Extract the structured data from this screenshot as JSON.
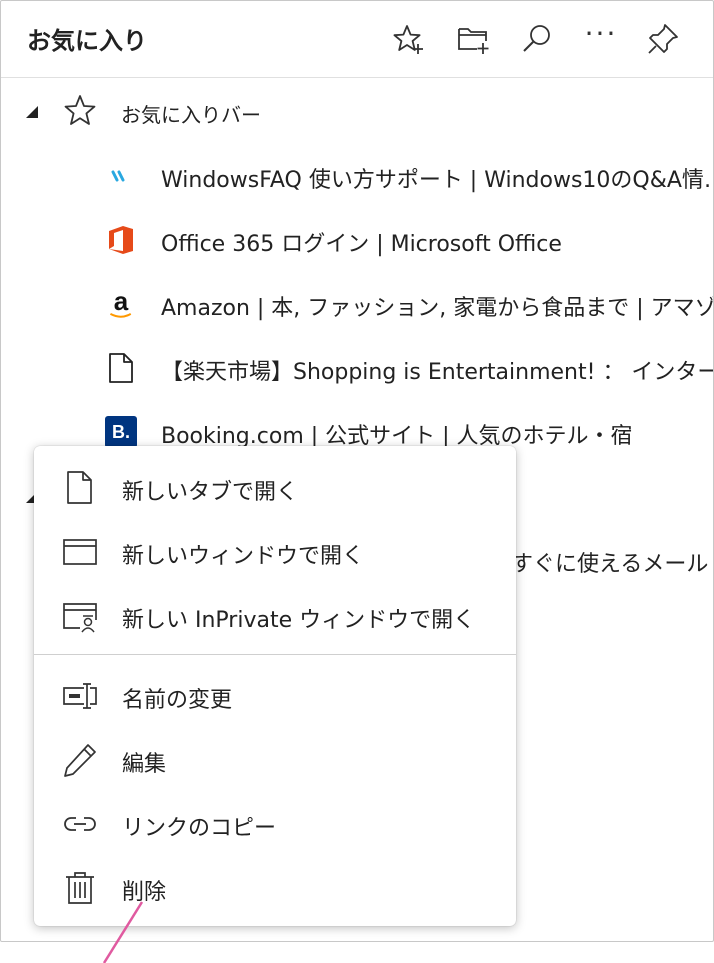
{
  "header": {
    "title": "お気に入り",
    "actions": [
      {
        "name": "add-favorite",
        "icon": "star-plus-icon"
      },
      {
        "name": "add-folder",
        "icon": "folder-plus-icon"
      },
      {
        "name": "search",
        "icon": "search-icon"
      },
      {
        "name": "more",
        "icon": "more-icon",
        "label": "···"
      },
      {
        "name": "pin",
        "icon": "pin-icon"
      }
    ]
  },
  "tree": {
    "folder": {
      "label": "お気に入りバー",
      "icon": "star-icon",
      "expanded": true
    },
    "items": [
      {
        "label": "WindowsFAQ 使い方サポート | Windows10のQ&A情…",
        "icon": "windowsfaq-icon"
      },
      {
        "label": "Office 365 ログイン | Microsoft Office",
        "icon": "office-icon"
      },
      {
        "label": "Amazon | 本, ファッション, 家電から食品まで | アマゾン",
        "icon": "amazon-icon",
        "icon_text": "a"
      },
      {
        "label": "【楽天市場】Shopping is Entertainment! ： インター…",
        "icon": "page-icon"
      },
      {
        "label": "Booking.com | 公式サイト | 人気のホテル・宿",
        "icon": "booking-icon",
        "icon_text": "B."
      }
    ],
    "partial_item": {
      "label": "すぐに使えるメール"
    }
  },
  "context_menu": {
    "items": [
      {
        "label": "新しいタブで開く",
        "icon": "new-tab-icon"
      },
      {
        "label": "新しいウィンドウで開く",
        "icon": "new-window-icon"
      },
      {
        "label": "新しい InPrivate ウィンドウで開く",
        "icon": "inprivate-window-icon"
      },
      {
        "label": "名前の変更",
        "icon": "rename-icon"
      },
      {
        "label": "編集",
        "icon": "edit-pencil-icon"
      },
      {
        "label": "リンクのコピー",
        "icon": "link-icon"
      },
      {
        "label": "削除",
        "icon": "trash-icon"
      }
    ]
  },
  "colors": {
    "office_red": "#e64a19",
    "amazon_orange": "#ff9900",
    "booking_blue": "#003580",
    "windowsfaq_cyan": "#29a8e0",
    "pointer_pink": "#e05aa0"
  }
}
